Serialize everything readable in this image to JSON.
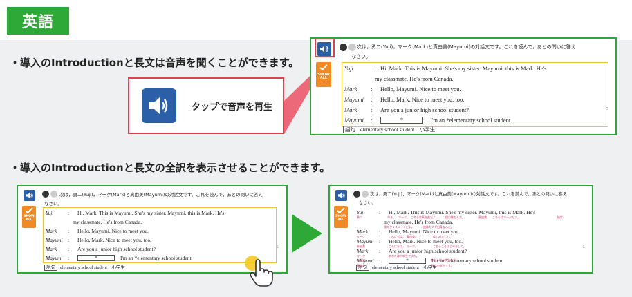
{
  "subject": {
    "label": "英語"
  },
  "features": {
    "audio": "・導入のIntroductionと長文は音声を聞くことができます。",
    "translation": "・導入のIntroductionと長文の全訳を表示させることができます。"
  },
  "callout": {
    "label": "タップで音声を再生"
  },
  "book": {
    "showall": [
      "SHOW",
      "ALL"
    ],
    "instruction_line1": "次は，勇二(Yuji)，マーク(Mark)と真由美(Mayumi)の対話文です。これを読んで，あとの問いに答え",
    "instruction_line2": "なさい。",
    "lines": [
      {
        "speaker": "Yuji",
        "text": "Hi, Mark.  This is Mayumi.  She's my sister.  Mayumi, this is Mark.  He's"
      },
      {
        "speaker": "",
        "text": "my classmate.  He's from Canada."
      },
      {
        "speaker": "Mark",
        "text": "Hello, Mayumi.  Nice to meet you."
      },
      {
        "speaker": "Mayumi",
        "text": "Hello, Mark.  Nice to meet you, too."
      },
      {
        "speaker": "Mark",
        "text": "Are you a junior high school student?"
      },
      {
        "speaker": "Mayumi",
        "text": "I'm an *elementary school student."
      }
    ],
    "colon": ":",
    "blank_mark": "＊",
    "vocab_tag": "語句",
    "vocab_text": "elementary school student　小学生",
    "line_number": "5"
  },
  "translations": {
    "yuji": [
      "勇二",
      "やあ，",
      "マーク。",
      "こちらは真由美だよ。",
      "僕の妹なんだ。",
      "真由美，",
      "こちらはマークだよ。",
      "彼は"
    ],
    "line2": [
      "僕のクラスメイトだよ。",
      "彼はカナダ出身なんだ。"
    ],
    "mark1": [
      "マーク",
      "こんにちは，",
      "真由美。",
      "はじめまして。"
    ],
    "mayumi1": [
      "真由美",
      "こんにちは，",
      "マーク。",
      "こちらこそはじめまして。"
    ],
    "mark2": [
      "マーク",
      "あなたは中学生ですか。"
    ],
    "mayumi2": [
      "真由美",
      "私は小学生です。"
    ],
    "vocab": [
      "小学生",
      "わたしは小学生です。"
    ]
  },
  "colors": {
    "green": "#2ea836",
    "blue": "#2b5fa8",
    "orange": "#f08a24",
    "red": "#e0404f",
    "yellow": "#f1c232",
    "pink": "#d6336c"
  }
}
